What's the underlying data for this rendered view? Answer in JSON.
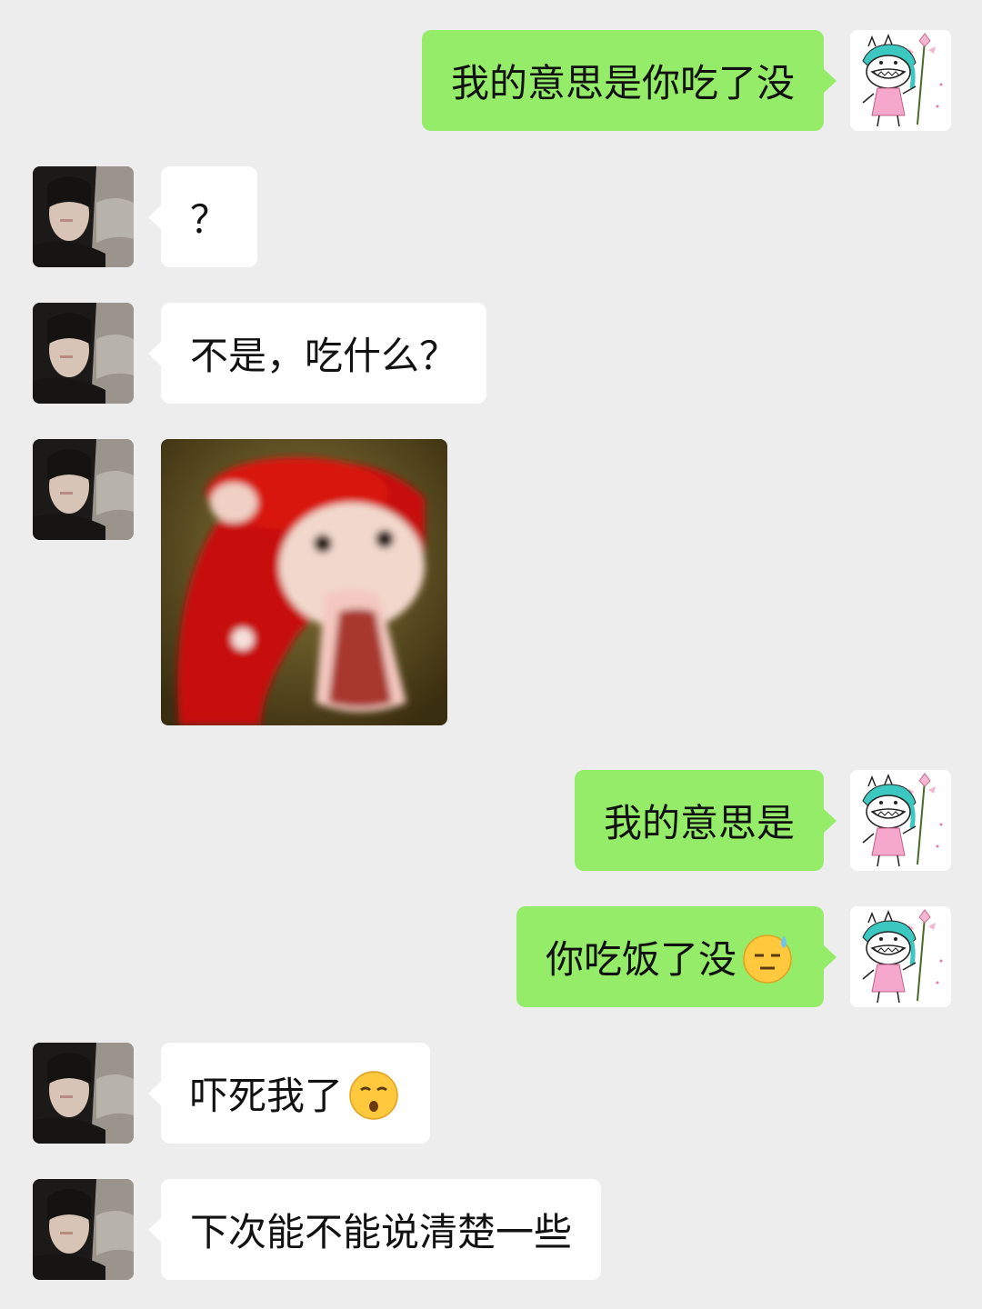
{
  "messages": [
    {
      "side": "right",
      "text": "我的意思是你吃了没"
    },
    {
      "side": "left",
      "text": "？"
    },
    {
      "side": "left",
      "text": "不是，吃什么？"
    },
    {
      "side": "left",
      "type": "sticker",
      "sticker": "screaming-red-hood-meme"
    },
    {
      "side": "right",
      "text": "我的意思是"
    },
    {
      "side": "right",
      "text": "你吃饭了没",
      "emoji": "sweat-smile-emoji"
    },
    {
      "side": "left",
      "text": "吓死我了",
      "emoji": "relieved-whistle-emoji"
    },
    {
      "side": "left",
      "text": "下次能不能说清楚一些"
    }
  ],
  "colors": {
    "background": "#ededed",
    "self_bubble": "#95ec69",
    "other_bubble": "#ffffff"
  }
}
